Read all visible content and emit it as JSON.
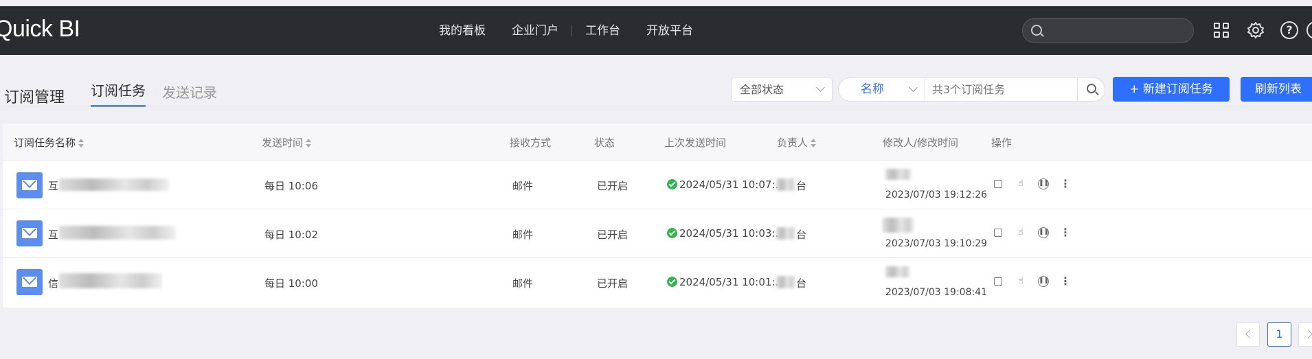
{
  "app": {
    "logo": "Quick BI"
  },
  "nav": [
    "我的看板",
    "企业门户",
    "工作台",
    "开放平台"
  ],
  "tabs": {
    "title": "订阅管理",
    "items": [
      "订阅任务",
      "发送记录"
    ]
  },
  "filters": {
    "status": "全部状态",
    "field": "名称",
    "search_placeholder": "共3个订阅任务"
  },
  "buttons": {
    "new": "+ 新建订阅任务",
    "refresh": "刷新列表"
  },
  "table": {
    "columns": [
      "订阅任务名称",
      "发送时间",
      "接收方式",
      "状态",
      "上次发送时间",
      "负责人",
      "修改人/修改时间",
      "操作"
    ],
    "rows": [
      {
        "name": "互",
        "send_time": "每日 10:06",
        "method": "邮件",
        "status": "已开启",
        "last_sent": "2024/05/31 10:07:...",
        "owner": "台",
        "modified": "2023/07/03 19:12:26"
      },
      {
        "name": "互",
        "send_time": "每日 10:02",
        "method": "邮件",
        "status": "已开启",
        "last_sent": "2024/05/31 10:03:...",
        "owner": "台",
        "modified": "2023/07/03 19:10:29"
      },
      {
        "name": "信",
        "send_time": "每日 10:00",
        "method": "邮件",
        "status": "已开启",
        "last_sent": "2024/05/31 10:01:...",
        "owner": "台",
        "modified": "2023/07/03 19:08:41"
      }
    ]
  },
  "pagination": {
    "current": "1"
  }
}
